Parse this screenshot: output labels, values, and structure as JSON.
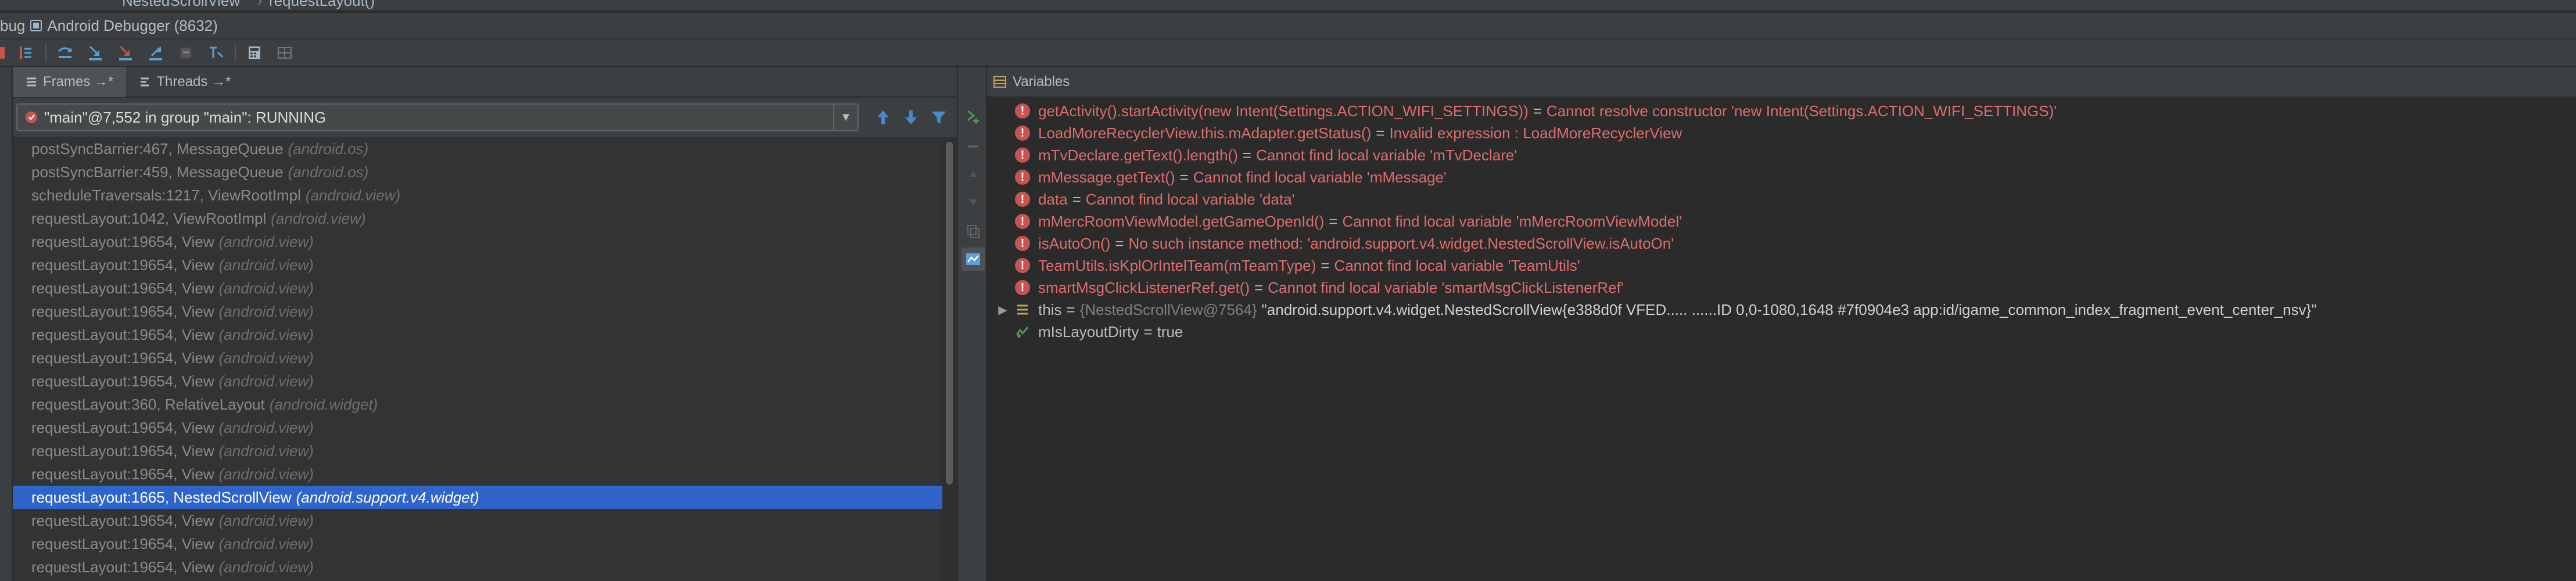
{
  "breadcrumb": {
    "items": [
      "NestedScrollView",
      "requestLayout()"
    ]
  },
  "titlebar": {
    "prefix": "bug",
    "title": "Android Debugger (8632)"
  },
  "frames_panel": {
    "tabs": [
      {
        "label": "Frames →*"
      },
      {
        "label": "Threads →*"
      }
    ],
    "thread_selector": {
      "value": "\"main\"@7,552 in group \"main\": RUNNING"
    },
    "frames": [
      {
        "method": "postSyncBarrier:467, MessageQueue",
        "package": "(android.os)"
      },
      {
        "method": "postSyncBarrier:459, MessageQueue",
        "package": "(android.os)"
      },
      {
        "method": "scheduleTraversals:1217, ViewRootImpl",
        "package": "(android.view)"
      },
      {
        "method": "requestLayout:1042, ViewRootImpl",
        "package": "(android.view)"
      },
      {
        "method": "requestLayout:19654, View",
        "package": "(android.view)"
      },
      {
        "method": "requestLayout:19654, View",
        "package": "(android.view)"
      },
      {
        "method": "requestLayout:19654, View",
        "package": "(android.view)"
      },
      {
        "method": "requestLayout:19654, View",
        "package": "(android.view)"
      },
      {
        "method": "requestLayout:19654, View",
        "package": "(android.view)"
      },
      {
        "method": "requestLayout:19654, View",
        "package": "(android.view)"
      },
      {
        "method": "requestLayout:19654, View",
        "package": "(android.view)"
      },
      {
        "method": "requestLayout:360, RelativeLayout",
        "package": "(android.widget)"
      },
      {
        "method": "requestLayout:19654, View",
        "package": "(android.view)"
      },
      {
        "method": "requestLayout:19654, View",
        "package": "(android.view)"
      },
      {
        "method": "requestLayout:19654, View",
        "package": "(android.view)"
      },
      {
        "method": "requestLayout:1665, NestedScrollView",
        "package": "(android.support.v4.widget)",
        "selected": true
      },
      {
        "method": "requestLayout:19654, View",
        "package": "(android.view)"
      },
      {
        "method": "requestLayout:19654, View",
        "package": "(android.view)"
      },
      {
        "method": "requestLayout:19654, View",
        "package": "(android.view)"
      }
    ]
  },
  "variables_panel": {
    "title": "Variables",
    "errors": [
      {
        "expr": "getActivity().startActivity(new Intent(Settings.ACTION_WIFI_SETTINGS))",
        "message": "Cannot resolve constructor 'new Intent(Settings.ACTION_WIFI_SETTINGS)'"
      },
      {
        "expr": "LoadMoreRecyclerView.this.mAdapter.getStatus()",
        "message": "Invalid expression : LoadMoreRecyclerView"
      },
      {
        "expr": "mTvDeclare.getText().length()",
        "message": "Cannot find local variable 'mTvDeclare'"
      },
      {
        "expr": "mMessage.getText()",
        "message": "Cannot find local variable 'mMessage'"
      },
      {
        "expr": "data",
        "message": "Cannot find local variable 'data'"
      },
      {
        "expr": "mMercRoomViewModel.getGameOpenId()",
        "message": "Cannot find local variable 'mMercRoomViewModel'"
      },
      {
        "expr": "isAutoOn()",
        "message": "No such instance method: 'android.support.v4.widget.NestedScrollView.isAutoOn'"
      },
      {
        "expr": "TeamUtils.isKplOrIntelTeam(mTeamType)",
        "message": "Cannot find local variable 'TeamUtils'"
      },
      {
        "expr": "smartMsgClickListenerRef.get()",
        "message": "Cannot find local variable 'smartMsgClickListenerRef'"
      }
    ],
    "this_var": {
      "name": "this",
      "object": "{NestedScrollView@7564}",
      "value": "\"android.support.v4.widget.NestedScrollView{e388d0f VFED..... ......ID 0,0-1080,1648 #7f0904e3 app:id/igame_common_index_fragment_event_center_nsv}\""
    },
    "field_var": {
      "name": "mIsLayoutDirty",
      "value": "true"
    }
  },
  "colors": {
    "selection": "#2f65ca",
    "error": "#e06c6c",
    "accent": "#4a88c7"
  }
}
